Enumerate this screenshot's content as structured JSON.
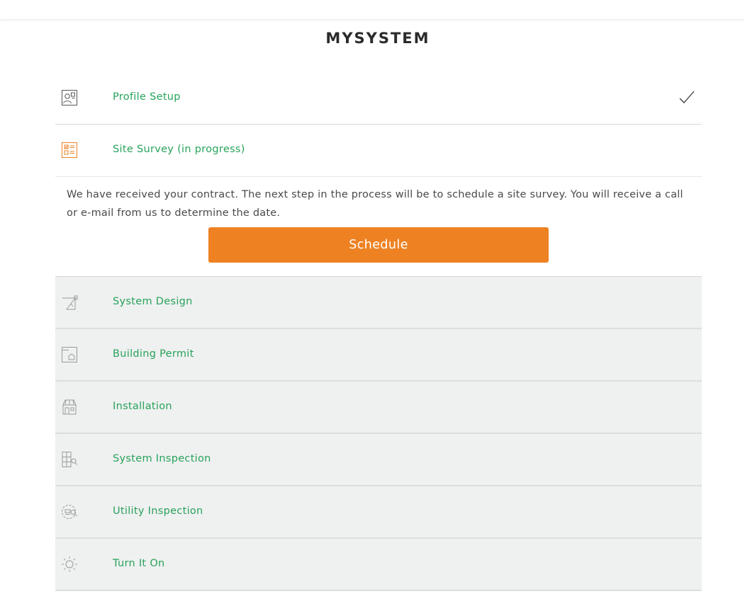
{
  "header": {
    "brand": "MYSYSTEM"
  },
  "colors": {
    "accent_green": "#27a35b",
    "active_orange": "#ee8223",
    "pending_background": "#eff0f0"
  },
  "steps": [
    {
      "label": "Profile Setup",
      "icon": "profile-card-icon",
      "status": "complete"
    },
    {
      "label": "Site Survey (in progress)",
      "icon": "checklist-icon",
      "status": "in-progress"
    },
    {
      "label": "System Design",
      "icon": "design-tools-icon",
      "status": "pending"
    },
    {
      "label": "Building Permit",
      "icon": "permit-document-icon",
      "status": "pending"
    },
    {
      "label": "Installation",
      "icon": "house-install-icon",
      "status": "pending"
    },
    {
      "label": "System Inspection",
      "icon": "panel-inspect-icon",
      "status": "pending"
    },
    {
      "label": "Utility Inspection",
      "icon": "meter-inspect-icon",
      "status": "pending"
    },
    {
      "label": "Turn It On",
      "icon": "sun-icon",
      "status": "pending"
    }
  ],
  "site_survey": {
    "message": "We have received your contract. The next step in the process will be to schedule a site survey. You will receive a call or e-mail from us to determine the date.",
    "button_label": "Schedule"
  }
}
